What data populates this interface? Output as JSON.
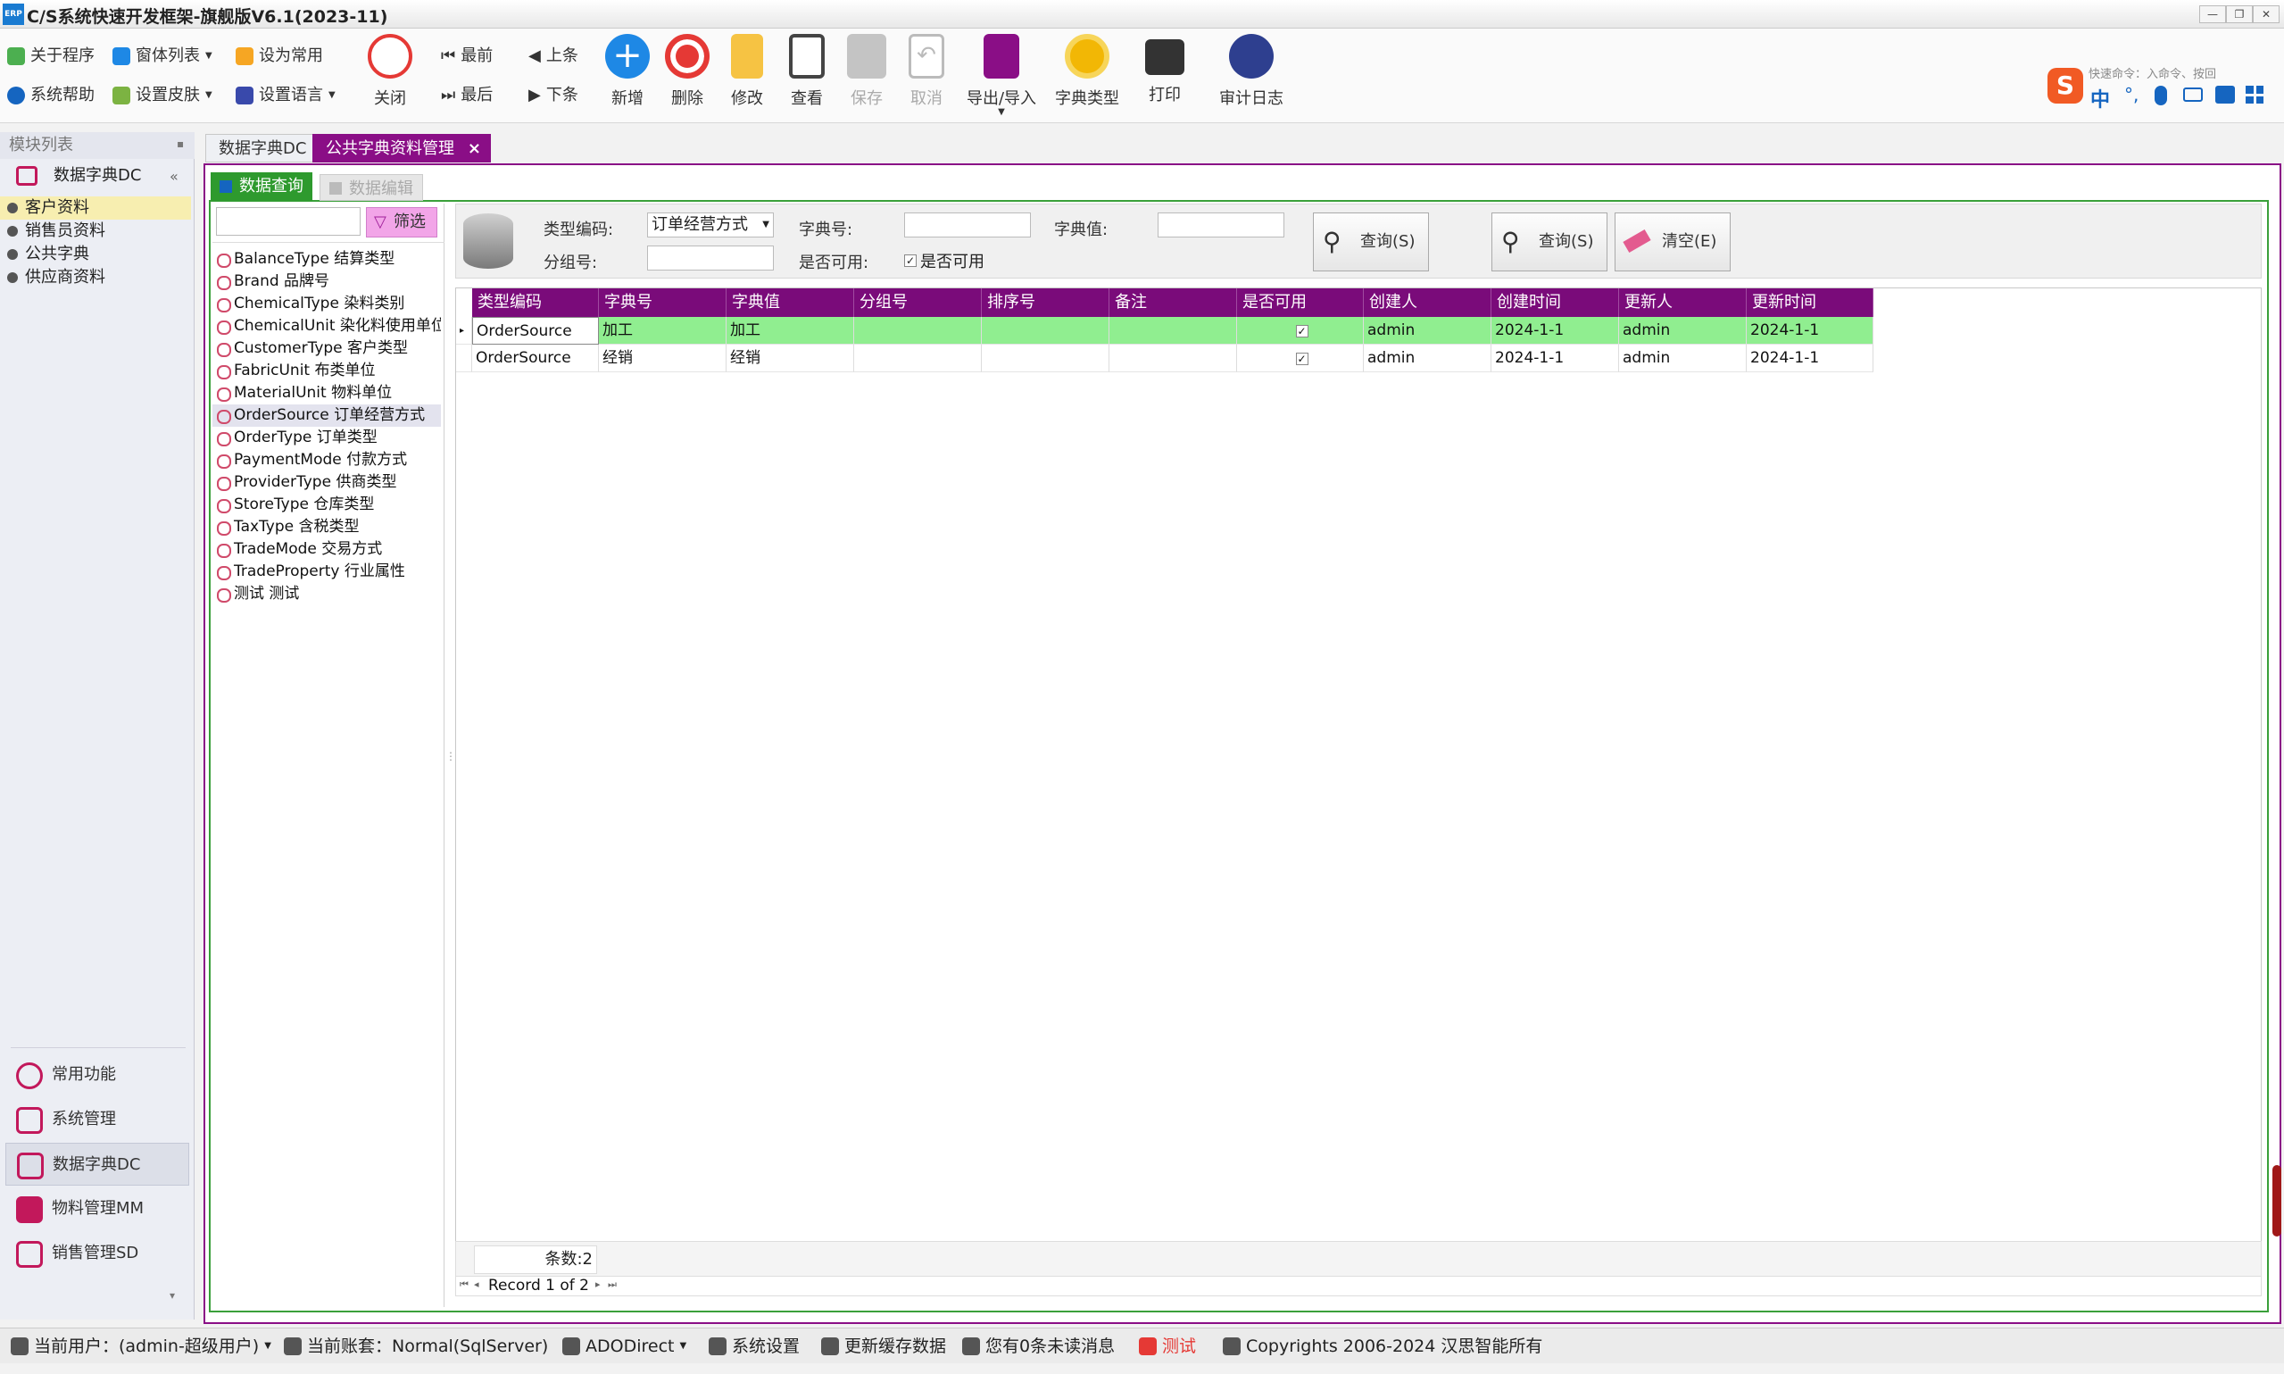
{
  "window": {
    "title": "C/S系统快速开发框架-旗舰版V6.1(2023-11)",
    "logo": "ERP"
  },
  "toolbar": {
    "small": [
      {
        "label": "关于程序",
        "icon": "about-icon"
      },
      {
        "label": "窗体列表",
        "icon": "window-list-icon"
      },
      {
        "label": "设为常用",
        "icon": "favorite-icon"
      },
      {
        "label": "系统帮助",
        "icon": "help-icon"
      },
      {
        "label": "设置皮肤",
        "icon": "skin-icon"
      },
      {
        "label": "设置语言",
        "icon": "language-icon"
      }
    ],
    "nav": {
      "first": "最前",
      "prev": "上条",
      "last": "最后",
      "next": "下条"
    },
    "big": [
      {
        "label": "关闭",
        "icon": "power-icon",
        "color": "#e53935"
      },
      {
        "label": "新增",
        "icon": "add-icon",
        "color": "#1e88e5"
      },
      {
        "label": "删除",
        "icon": "delete-icon",
        "color": "#e53935"
      },
      {
        "label": "修改",
        "icon": "edit-icon",
        "color": "#f6c343"
      },
      {
        "label": "查看",
        "icon": "view-icon",
        "color": "#555555"
      },
      {
        "label": "保存",
        "icon": "save-icon",
        "color": "#bbbbbb"
      },
      {
        "label": "取消",
        "icon": "undo-icon",
        "color": "#bbbbbb"
      },
      {
        "label": "导出/导入",
        "icon": "export-icon",
        "color": "#8a0e86"
      },
      {
        "label": "字典类型",
        "icon": "dict-type-icon",
        "color": "#f2b705"
      },
      {
        "label": "打印",
        "icon": "print-icon",
        "color": "#333333"
      },
      {
        "label": "审计日志",
        "icon": "audit-log-icon",
        "color": "#2e3f8f"
      }
    ]
  },
  "sogou": {
    "lang": "中",
    "placeholder": "快速命令：入命令、按回"
  },
  "leftpanel": {
    "header": "模块列表",
    "module": "数据字典DC",
    "tree": [
      "客户资料",
      "销售员资料",
      "公共字典",
      "供应商资料"
    ],
    "nav": [
      {
        "label": "常用功能",
        "icon": "star-icon"
      },
      {
        "label": "系统管理",
        "icon": "system-icon"
      },
      {
        "label": "数据字典DC",
        "icon": "cart-icon"
      },
      {
        "label": "物料管理MM",
        "icon": "material-icon"
      },
      {
        "label": "销售管理SD",
        "icon": "sales-icon"
      }
    ]
  },
  "tabs": [
    "数据字典DC",
    "公共字典资料管理"
  ],
  "subtabs": [
    "数据查询",
    "数据编辑"
  ],
  "list": {
    "filter_label": "筛选",
    "items": [
      "BalanceType 结算类型",
      "Brand 品牌号",
      "ChemicalType 染料类别",
      "ChemicalUnit 染化料使用单位",
      "CustomerType 客户类型",
      "FabricUnit 布类单位",
      "MaterialUnit 物料单位",
      "OrderSource 订单经营方式",
      "OrderType 订单类型",
      "PaymentMode 付款方式",
      "ProviderType 供商类型",
      "StoreType 仓库类型",
      "TaxType 含税类型",
      "TradeMode 交易方式",
      "TradeProperty 行业属性",
      "测试 测试"
    ]
  },
  "search": {
    "type_label": "类型编码:",
    "type_value": "订单经营方式",
    "dictno_label": "字典号:",
    "dictval_label": "字典值:",
    "group_label": "分组号:",
    "enabled_label": "是否可用:",
    "enabled_check": "是否可用",
    "query1": "查询(S)",
    "query2": "查询(S)",
    "clear": "清空(E)"
  },
  "grid": {
    "columns": [
      "类型编码",
      "字典号",
      "字典值",
      "分组号",
      "排序号",
      "备注",
      "是否可用",
      "创建人",
      "创建时间",
      "更新人",
      "更新时间"
    ],
    "rows": [
      [
        "OrderSource",
        "加工",
        "加工",
        "",
        "",
        "",
        "✓",
        "admin",
        "2024-1-1",
        "admin",
        "2024-1-1"
      ],
      [
        "OrderSource",
        "经销",
        "经销",
        "",
        "",
        "",
        "✓",
        "admin",
        "2024-1-1",
        "admin",
        "2024-1-1"
      ]
    ],
    "count_label": "条数:2",
    "record": "Record 1 of 2"
  },
  "status": [
    {
      "label": "当前用户：(admin-超级用户)",
      "icon": "user-icon"
    },
    {
      "label": "当前账套：Normal(SqlServer)",
      "icon": "database-icon"
    },
    {
      "label": "ADODirect",
      "icon": "link-icon"
    },
    {
      "label": "系统设置",
      "icon": "settings-icon"
    },
    {
      "label": "更新缓存数据",
      "icon": "refresh-icon"
    },
    {
      "label": "您有0条未读消息",
      "icon": "mail-icon"
    },
    {
      "label": "测试",
      "icon": "test-icon"
    },
    {
      "label": "Copyrights 2006-2024 汉思智能所有",
      "icon": "cube-icon"
    }
  ],
  "colors": {
    "accent": "#8a0e86",
    "grid_header": "#7a0b7a",
    "selected_row": "#90ee90",
    "tab_green": "#3aa03a"
  }
}
